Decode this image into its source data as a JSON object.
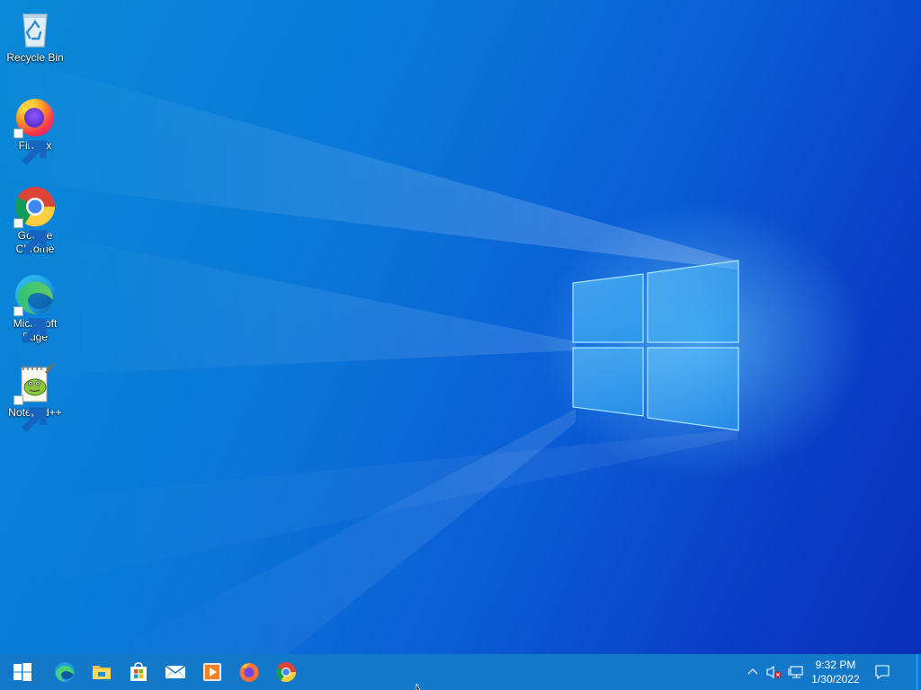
{
  "desktop": {
    "icons": [
      {
        "label": "Recycle Bin",
        "icon": "recycle-bin-icon",
        "shortcut": false
      },
      {
        "label": "Firefox",
        "icon": "firefox-icon",
        "shortcut": true
      },
      {
        "label": "Google Chrome",
        "icon": "chrome-icon",
        "shortcut": true
      },
      {
        "label": "Microsoft Edge",
        "icon": "edge-icon",
        "shortcut": true
      },
      {
        "label": "Notepad++",
        "icon": "notepad-plus-plus-icon",
        "shortcut": true
      }
    ]
  },
  "taskbar": {
    "start": {
      "icon": "windows-start-icon"
    },
    "pinned": [
      {
        "name": "Microsoft Edge",
        "icon": "edge-icon"
      },
      {
        "name": "File Explorer",
        "icon": "file-explorer-icon"
      },
      {
        "name": "Microsoft Store",
        "icon": "store-icon"
      },
      {
        "name": "Mail",
        "icon": "mail-icon"
      },
      {
        "name": "Media Player",
        "icon": "media-player-icon"
      },
      {
        "name": "Firefox",
        "icon": "firefox-icon"
      },
      {
        "name": "Google Chrome",
        "icon": "chrome-icon"
      }
    ],
    "tray": {
      "icons": [
        "show-hidden-icons-chevron-icon",
        "volume-muted-icon",
        "network-icon"
      ],
      "time": "9:32 PM",
      "date": "1/30/2022",
      "notification_icon": "action-center-icon"
    }
  },
  "colors": {
    "taskbar": "#1378c7",
    "wallpaper_light": "#0a8ad8",
    "wallpaper_dark": "#0a30b8"
  }
}
